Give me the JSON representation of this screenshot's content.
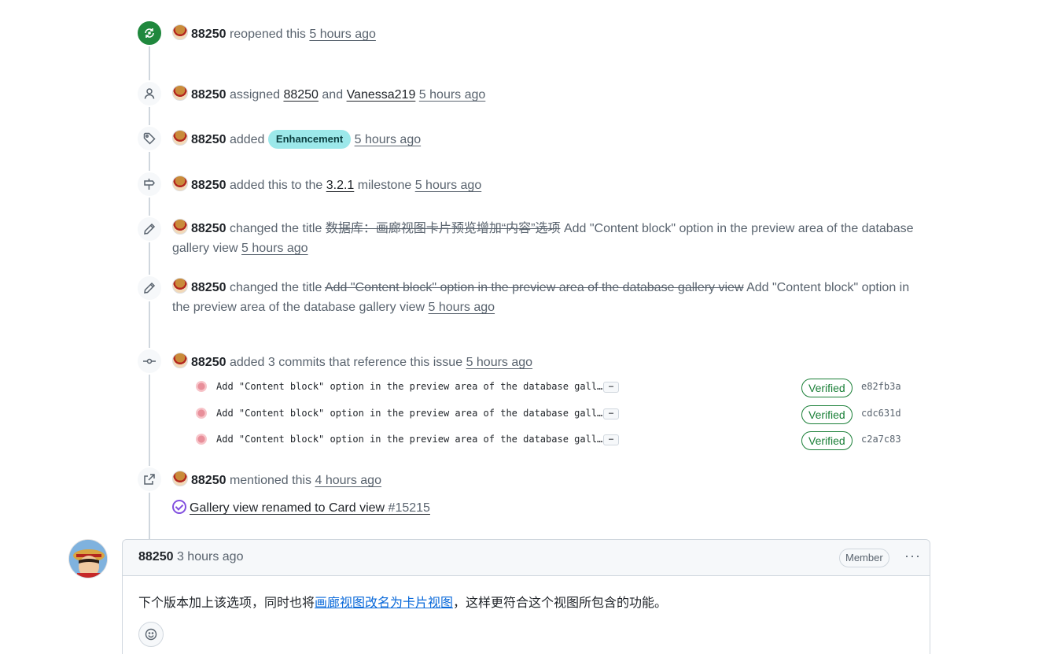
{
  "user": "88250",
  "events": {
    "reopen": {
      "verb": "reopened this",
      "time": "5 hours ago"
    },
    "assign": {
      "verb": "assigned",
      "a1": "88250",
      "and": "and",
      "a2": "Vanessa219",
      "time": "5 hours ago"
    },
    "label": {
      "verb": "added",
      "label": "Enhancement",
      "time": "5 hours ago",
      "color": "#9ce8ea"
    },
    "milestone": {
      "verb": "added this to the",
      "milestone": "3.2.1",
      "suffix": "milestone",
      "time": "5 hours ago"
    },
    "rename1": {
      "verb": "changed the title",
      "old": "数据库：画廊视图卡片预览增加“内容”选项",
      "new": "Add \"Content block\" option in the preview area of the database gallery view",
      "time": "5 hours ago"
    },
    "rename2": {
      "verb": "changed the title",
      "old": "Add \"Content block\" option in the preview area of the database gallery view",
      "new": "Add \"Content block\" option in the preview area of the database gallery view",
      "time": "5 hours ago"
    },
    "commits": {
      "verb": "added 3 commits that reference this issue",
      "time": "5 hours ago",
      "items": [
        {
          "msg": "Add \"Content block\" option in the preview area of the database gall…",
          "more": "…",
          "verified": "Verified",
          "sha": "e82fb3a"
        },
        {
          "msg": "Add \"Content block\" option in the preview area of the database gall…",
          "more": "…",
          "verified": "Verified",
          "sha": "cdc631d"
        },
        {
          "msg": "Add \"Content block\" option in the preview area of the database gall…",
          "more": "…",
          "verified": "Verified",
          "sha": "c2a7c83"
        }
      ]
    },
    "mention": {
      "verb": "mentioned this",
      "time": "4 hours ago",
      "ref_title": "Gallery view renamed to Card view",
      "ref_num": "#15215"
    }
  },
  "comment": {
    "author": "88250",
    "time": "3 hours ago",
    "role": "Member",
    "menu": "···",
    "text_before": "下个版本加上该选项，同时也将",
    "link": "画廊视图改名为卡片视图",
    "text_after": "，这样更符合这个视图所包含的功能。"
  },
  "icons": [
    "reopen-icon",
    "person-icon",
    "tag-icon",
    "milestone-icon",
    "pencil-icon",
    "commit-icon",
    "cross-reference-icon",
    "check-circle-icon",
    "smiley-icon"
  ]
}
